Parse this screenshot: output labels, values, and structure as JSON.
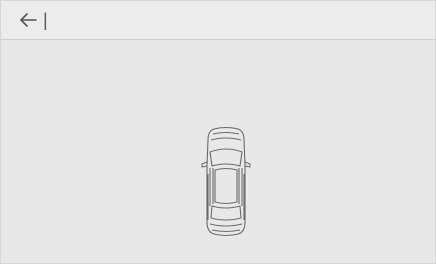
{
  "header": {
    "back_icon": "arrow-left-icon",
    "title": "|"
  },
  "car_view": {
    "icon": "car-top-view-icon"
  },
  "colors": {
    "background": "#e8e8e8",
    "line": "#6a6a6a"
  }
}
